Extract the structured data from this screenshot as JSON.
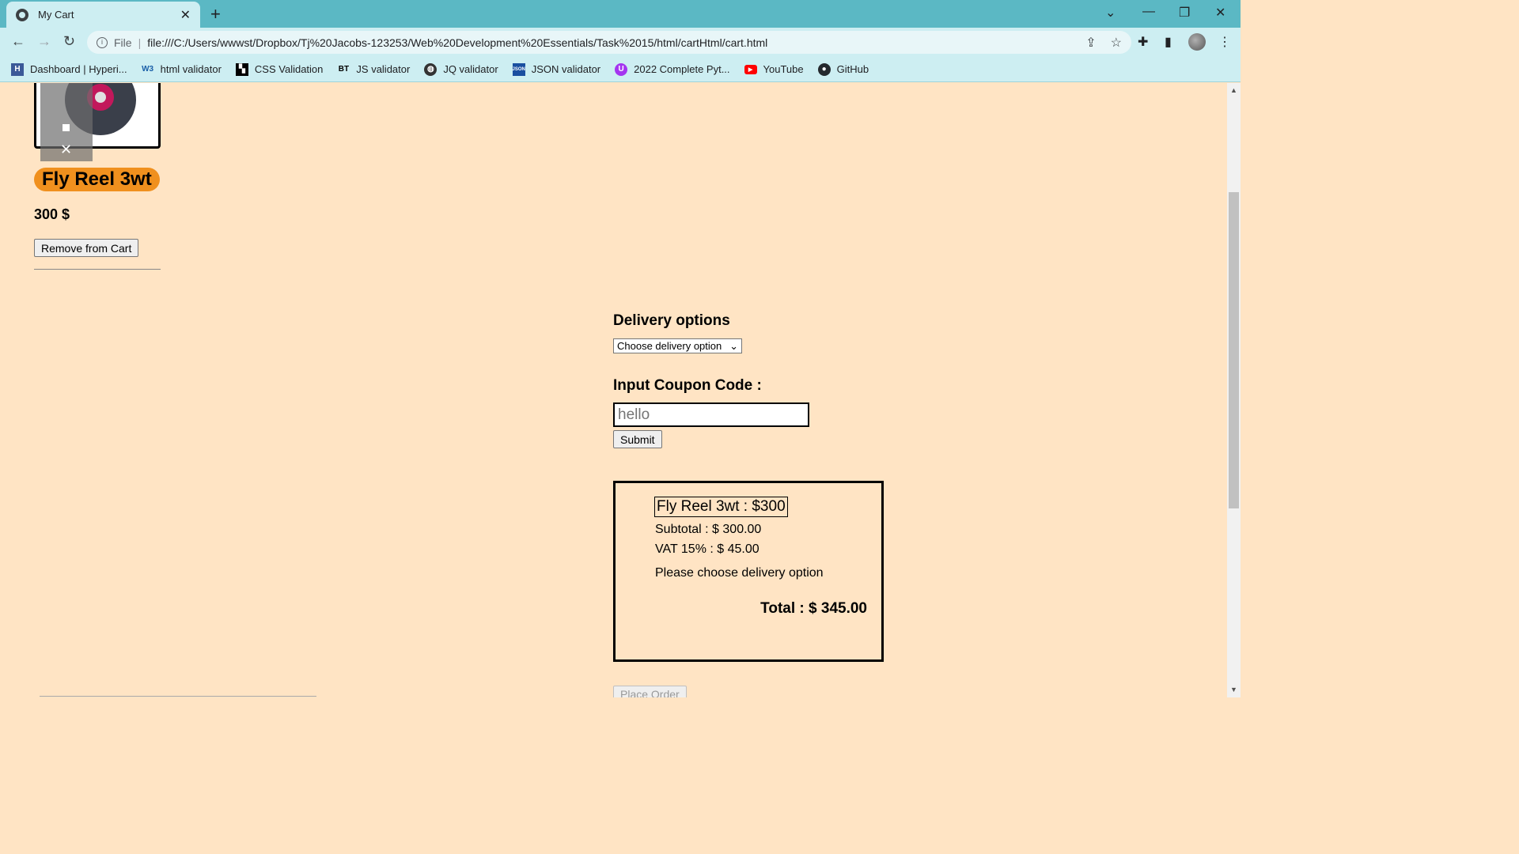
{
  "browser": {
    "tab_title": "My Cart",
    "url_scheme_label": "File",
    "url": "file:///C:/Users/wwwst/Dropbox/Tj%20Jacobs-123253/Web%20Development%20Essentials/Task%2015/html/cartHtml/cart.html",
    "bookmarks": [
      {
        "label": "Dashboard | Hyperi...",
        "icon": "hyperiondev-icon"
      },
      {
        "label": "html validator",
        "icon": "w3c-icon"
      },
      {
        "label": "CSS Validation",
        "icon": "css-icon"
      },
      {
        "label": "JS validator",
        "icon": "bt-icon"
      },
      {
        "label": "JQ validator",
        "icon": "globe-icon"
      },
      {
        "label": "JSON validator",
        "icon": "json-icon"
      },
      {
        "label": "2022 Complete Pyt...",
        "icon": "udemy-icon"
      },
      {
        "label": "YouTube",
        "icon": "youtube-icon"
      },
      {
        "label": "GitHub",
        "icon": "github-icon"
      }
    ]
  },
  "cart": {
    "product": {
      "name": "Fly Reel 3wt",
      "price": "300 $",
      "remove_label": "Remove from Cart"
    },
    "delivery": {
      "heading": "Delivery options",
      "selected": "Choose delivery option"
    },
    "coupon": {
      "heading": "Input Coupon Code :",
      "value": "hello",
      "submit_label": "Submit"
    },
    "summary": {
      "item_line": "Fly Reel 3wt : $300",
      "subtotal": "Subtotal : $ 300.00",
      "vat": "VAT 15% : $ 45.00",
      "delivery_note": "Please choose delivery option",
      "total": "Total : $ 345.00"
    },
    "place_order_label": "Place Order"
  },
  "colors": {
    "page_bg": "#ffe4c4",
    "chrome_teal": "#5bb8c4",
    "product_badge": "#f0901e"
  }
}
